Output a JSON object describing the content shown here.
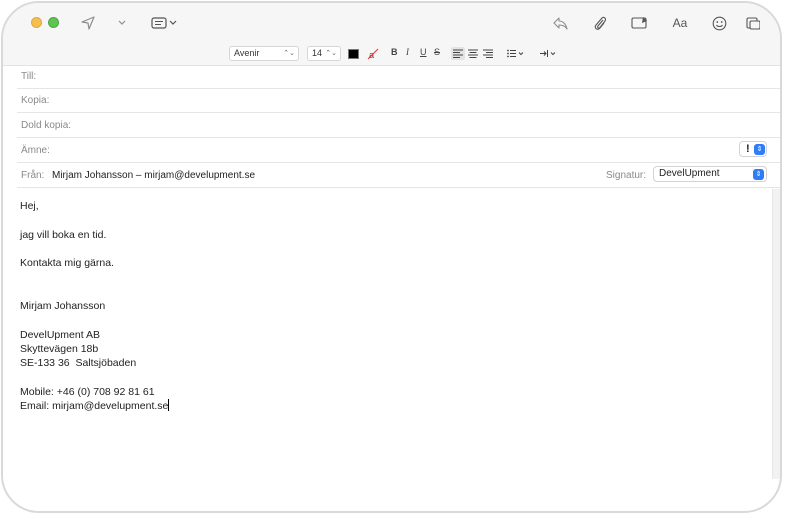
{
  "toolbar": {
    "icons": [
      "send-icon",
      "chevron-down-icon",
      "header-fields-icon",
      "reply-icon",
      "attachment-icon",
      "photo-browser-icon",
      "format-icon",
      "emoji-icon",
      "photo-icon"
    ],
    "format_label": "Aa"
  },
  "formatbar": {
    "font": "Avenir",
    "size": "14",
    "text_color": "#000000",
    "bold": "B",
    "italic": "I",
    "underline": "U",
    "strike": "S"
  },
  "headers": {
    "to_label": "Till:",
    "cc_label": "Kopia:",
    "bcc_label": "Dold kopia:",
    "subject_label": "Ämne:",
    "from_label": "Från:",
    "from_value": "Mirjam Johansson – mirjam@develupment.se",
    "signature_label": "Signatur:",
    "signature_value": "DevelUpment",
    "priority_mark": "!"
  },
  "message": {
    "lines": [
      "Hej,",
      "",
      "jag vill boka en tid.",
      "",
      "Kontakta mig gärna.",
      "",
      "",
      "Mirjam Johansson",
      "",
      "DevelUpment AB",
      "Skyttevägen 18b",
      "SE-133 36  Saltsjöbaden",
      "",
      "Mobile: +46 (0) 708 92 81 61",
      "Email: mirjam@develupment.se"
    ]
  },
  "colors": {
    "accent": "#2f7cf6",
    "toolbar_bg": "#f6f6f6",
    "traffic_yellow": "#f6be4f",
    "traffic_green": "#5fc454"
  }
}
